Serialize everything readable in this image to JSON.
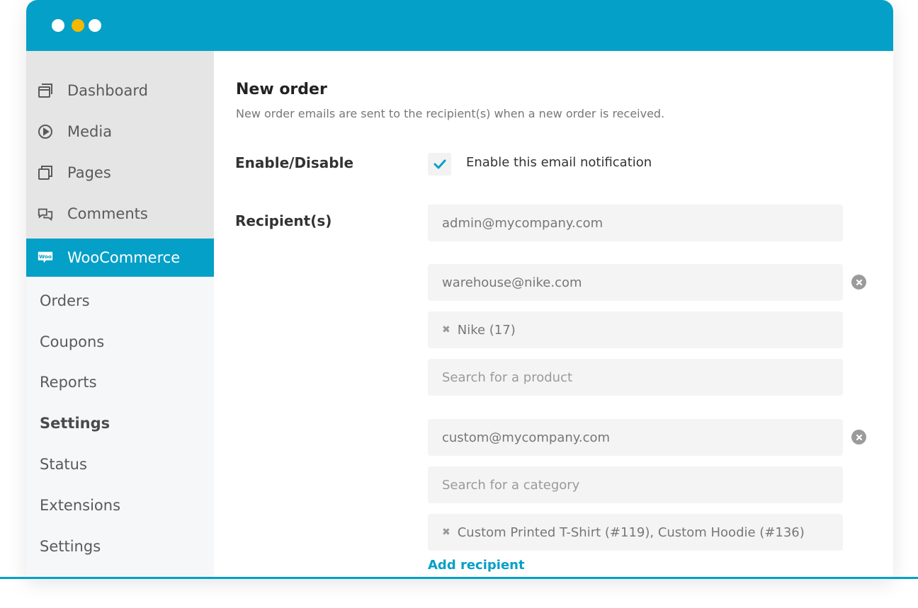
{
  "window": {
    "dots": [
      {
        "name": "close",
        "color": "#ffffff"
      },
      {
        "name": "minimize",
        "color": "#f5b800"
      },
      {
        "name": "maximize",
        "color": "#ffffff"
      }
    ],
    "accent_color": "#04a0c8"
  },
  "sidebar": {
    "main_items": [
      {
        "label": "Dashboard",
        "icon": "dashboard-icon"
      },
      {
        "label": "Media",
        "icon": "play-icon"
      },
      {
        "label": "Pages",
        "icon": "pages-icon"
      },
      {
        "label": "Comments",
        "icon": "comments-icon"
      },
      {
        "label": "WooCommerce",
        "icon": "woocommerce-icon",
        "active": true
      }
    ],
    "sub_items": [
      {
        "label": "Orders"
      },
      {
        "label": "Coupons"
      },
      {
        "label": "Reports"
      },
      {
        "label": "Settings",
        "bold": true
      },
      {
        "label": "Status"
      },
      {
        "label": "Extensions"
      },
      {
        "label": "Settings"
      }
    ]
  },
  "main": {
    "title": "New order",
    "description": "New order emails are sent to the recipient(s) when a new order is received.",
    "enable": {
      "label": "Enable/Disable",
      "checkbox_label": "Enable this email notification",
      "checked": true
    },
    "recipients": {
      "label": "Recipient(s)",
      "primary_email": "admin@mycompany.com",
      "groups": [
        {
          "email": "warehouse@nike.com",
          "tag": "Nike (17)",
          "search_placeholder": "Search for a product"
        },
        {
          "email": "custom@mycompany.com",
          "search_placeholder": "Search for a category",
          "tag": "Custom Printed T-Shirt (#119), Custom Hoodie (#136)"
        }
      ],
      "add_label": "Add recipient"
    }
  }
}
